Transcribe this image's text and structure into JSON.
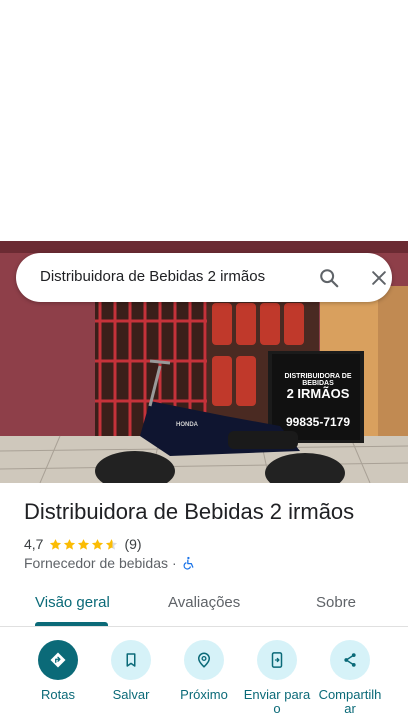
{
  "search": {
    "query": "Distribuidora de Bebidas 2 irmãos"
  },
  "place": {
    "title": "Distribuidora de Bebidas 2 irmãos",
    "rating": "4,7",
    "stars": 4.7,
    "reviews": "(9)",
    "category": "Fornecedor de bebidas",
    "separator": "·",
    "accessible_icon": "wheelchair-icon"
  },
  "photo": {
    "sign_line1": "DISTRIBUIDORA DE BEBIDAS",
    "sign_line2": "2 IRMÃOS",
    "sign_phone": "99835-7179",
    "bike_brand": "HONDA"
  },
  "tabs": [
    {
      "label": "Visão geral",
      "active": true
    },
    {
      "label": "Avaliações"
    },
    {
      "label": "Sobre"
    }
  ],
  "actions": [
    {
      "label": "Rotas",
      "icon": "directions-icon"
    },
    {
      "label": "Salvar",
      "icon": "bookmark-icon"
    },
    {
      "label": "Próximo",
      "icon": "nearby-icon"
    },
    {
      "label": "Enviar para o",
      "icon": "send-to-phone-icon"
    },
    {
      "label": "Compartilhar",
      "icon": "share-icon"
    }
  ],
  "colors": {
    "accent": "#0b6a78",
    "accent_light": "#d6f2f8",
    "star": "#fbbc04"
  }
}
